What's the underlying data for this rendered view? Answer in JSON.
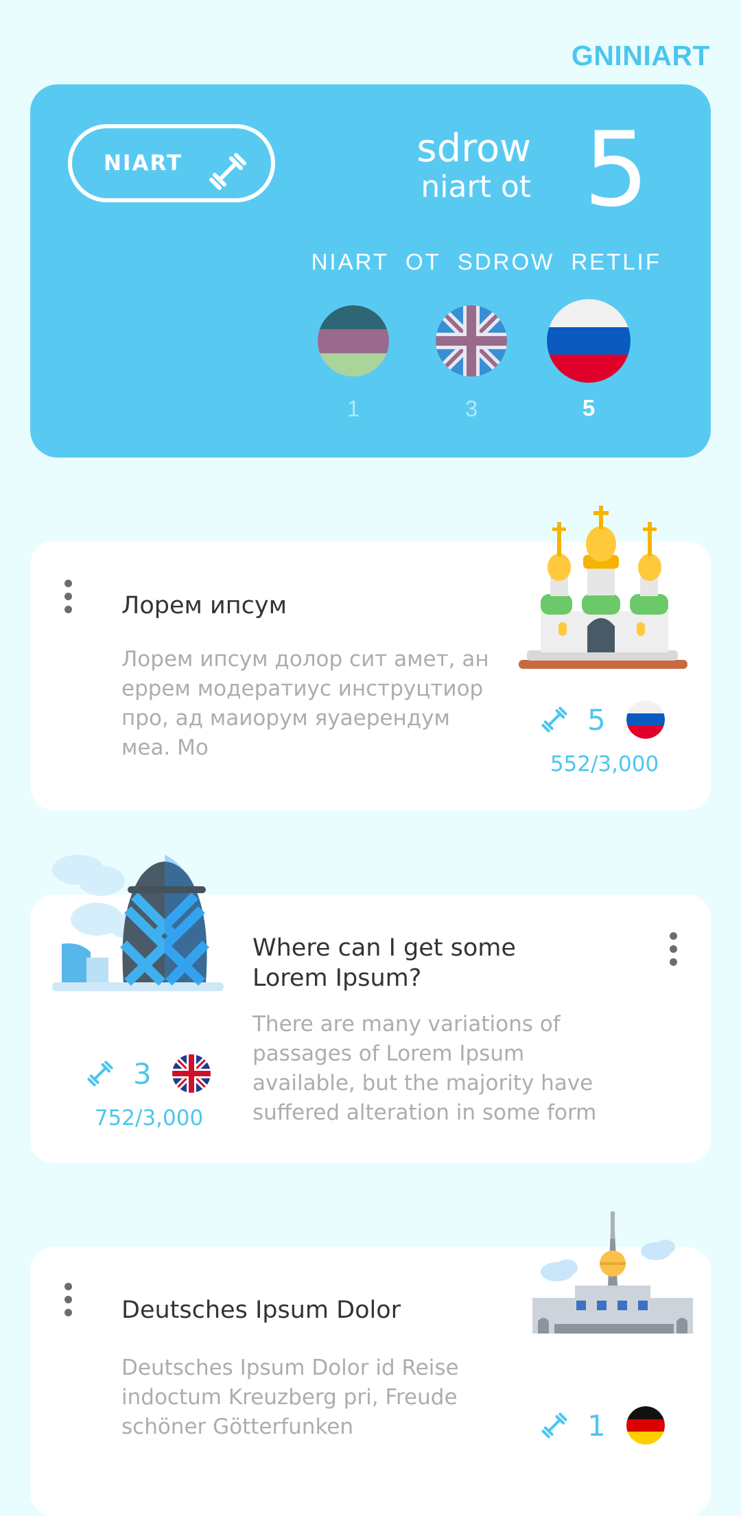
{
  "header": {
    "title": "GNINIART"
  },
  "hero": {
    "train_label": "NIART",
    "words_line1": "sdrow",
    "words_line2": "niart ot",
    "word_count": "5",
    "filter_words": [
      "NIART",
      "OT",
      "SDROW",
      "RETLIF"
    ],
    "flags": [
      {
        "name": "german-style",
        "count": "1",
        "selected": false
      },
      {
        "name": "uk",
        "count": "3",
        "selected": false
      },
      {
        "name": "russia",
        "count": "5",
        "selected": true
      }
    ]
  },
  "cards": [
    {
      "title": "Лорем ипсум",
      "description": "Лорем ипсум долор сит амет, ан еррем модератиус инструцтиор про, ад маиорум яуаерендум меа. Мо",
      "level": "5",
      "progress": "552/3,000",
      "flag": "russia",
      "illustration": "church-illustration"
    },
    {
      "title": "Where can I get some Lorem Ipsum?",
      "description": "There are many variations of passages of Lorem Ipsum available, but the majority have suffered alteration in some form",
      "level": "3",
      "progress": "752/3,000",
      "flag": "uk",
      "illustration": "gherkin-tower-illustration"
    },
    {
      "title": "Deutsches Ipsum Dolor",
      "description": "Deutsches Ipsum Dolor id Reise indoctum Kreuzberg pri, Freude schöner Götterfunken",
      "level": "1",
      "progress": "",
      "flag": "germany",
      "illustration": "tv-tower-illustration"
    }
  ],
  "colors": {
    "background": "#e9fdfe",
    "accent": "#58caf2",
    "accent_text": "#4cc6ee",
    "card": "#ffffff"
  }
}
